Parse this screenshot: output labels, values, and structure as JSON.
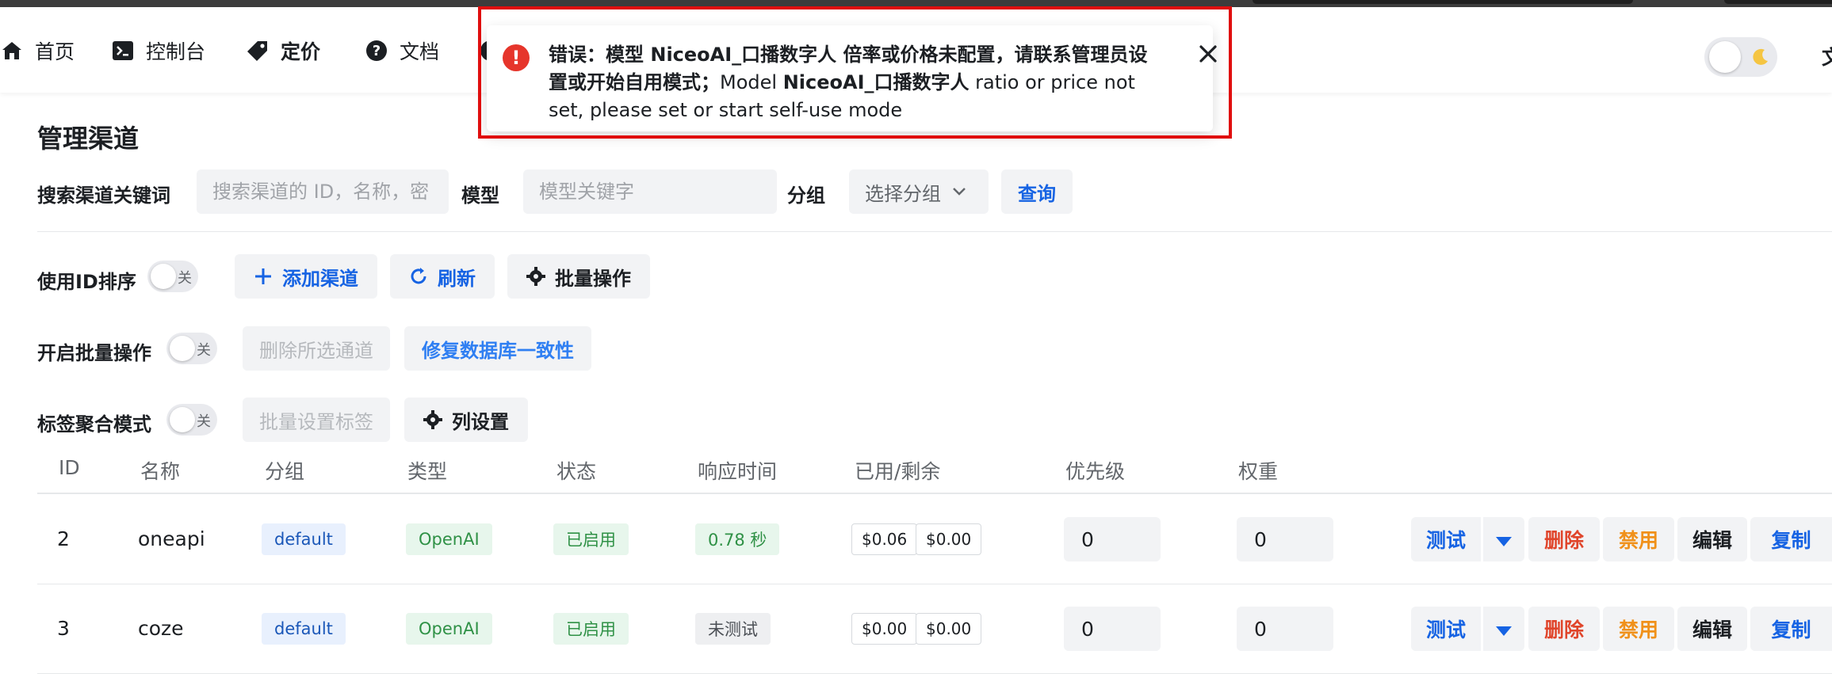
{
  "nav": {
    "items": [
      {
        "label": "首页",
        "icon": "home-icon"
      },
      {
        "label": "控制台",
        "icon": "terminal-icon"
      },
      {
        "label": "定价",
        "icon": "price-tag-icon"
      },
      {
        "label": "文档",
        "icon": "help-circle-icon"
      }
    ],
    "lang_label": "文"
  },
  "toast": {
    "bold_part": "错误：模型 NiceoAI_口播数字人 倍率或价格未配置，请联系管理员设置或开始自用模式；",
    "normal_part1": "Model ",
    "bold_part2": "NiceoAI_口播数字人",
    "normal_part2": " ratio or price not set, please set or start self-use mode",
    "border_color": "#e00d0d"
  },
  "page": {
    "title": "管理渠道"
  },
  "search": {
    "keyword_label": "搜索渠道关键词",
    "keyword_placeholder": "搜索渠道的 ID，名称，密",
    "model_label": "模型",
    "model_placeholder": "模型关键字",
    "group_label": "分组",
    "group_select": "选择分组",
    "query_button": "查询"
  },
  "toolbar1": {
    "sort_label": "使用ID排序",
    "sort_switch": "关",
    "add_button": "添加渠道",
    "refresh_button": "刷新",
    "batch_button": "批量操作"
  },
  "toolbar2": {
    "batch_label": "开启批量操作",
    "batch_switch": "关",
    "delete_selected": "删除所选通道",
    "fix_db": "修复数据库一致性"
  },
  "toolbar3": {
    "tag_label": "标签聚合模式",
    "tag_switch": "关",
    "batch_tag": "批量设置标签",
    "column_settings": "列设置"
  },
  "table": {
    "headers": [
      "ID",
      "名称",
      "分组",
      "类型",
      "状态",
      "响应时间",
      "已用/剩余",
      "优先级",
      "权重"
    ],
    "rows": [
      {
        "id": "2",
        "name": "oneapi",
        "group": "default",
        "type": "OpenAI",
        "status": "已启用",
        "response": "0.78 秒",
        "used": "$0.06",
        "remaining": "$0.00",
        "priority": "0",
        "weight": "0"
      },
      {
        "id": "3",
        "name": "coze",
        "group": "default",
        "type": "OpenAI",
        "status": "已启用",
        "response": "未测试",
        "used": "$0.00",
        "remaining": "$0.00",
        "priority": "0",
        "weight": "0"
      }
    ],
    "actions": {
      "test": "测试",
      "delete": "删除",
      "disable": "禁用",
      "edit": "编辑",
      "copy": "复制"
    }
  },
  "colors": {
    "primary": "#1663e3",
    "danger": "#e0452b",
    "warning": "#f0911a",
    "success": "#2f9146"
  }
}
